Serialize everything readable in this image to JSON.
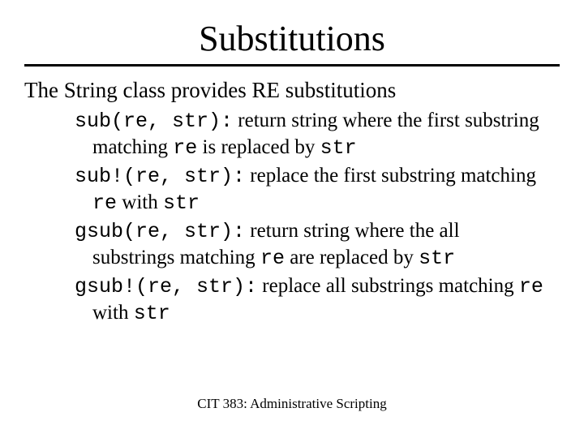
{
  "title": "Substitutions",
  "lead": "The String class provides RE substitutions",
  "items": [
    {
      "sig": "sub(re, str):",
      "pre": " return string where the first substring matching ",
      "arg1": "re",
      "mid": " is replaced by ",
      "arg2": "str"
    },
    {
      "sig": "sub!(re, str):",
      "pre": " replace  the first substring matching ",
      "arg1": "re",
      "mid": " with ",
      "arg2": "str"
    },
    {
      "sig": "gsub(re, str):",
      "pre": " return string where the all substrings matching ",
      "arg1": "re",
      "mid": " are replaced by ",
      "arg2": "str"
    },
    {
      "sig": "gsub!(re, str):",
      "pre": " replace  all substrings matching ",
      "arg1": "re",
      "mid": " with ",
      "arg2": "str"
    }
  ],
  "footer": "CIT 383: Administrative Scripting"
}
